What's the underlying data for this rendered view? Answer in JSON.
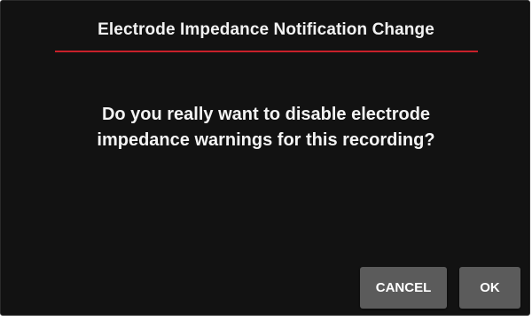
{
  "dialog": {
    "title": "Electrode Impedance Notification Change",
    "message_line1": "Do you really want to disable electrode",
    "message_line2": "impedance warnings for this recording?",
    "cancel_label": "CANCEL",
    "ok_label": "OK"
  },
  "colors": {
    "background": "#121212",
    "accent_rule": "#c8202a",
    "button": "#5b5b5b",
    "text": "#f2f2f2"
  }
}
